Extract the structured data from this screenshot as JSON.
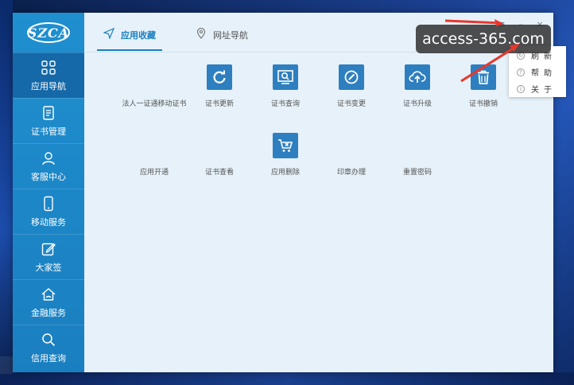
{
  "app": {
    "logo_text": "SZCA"
  },
  "sidebar": {
    "items": [
      {
        "label": "应用导航",
        "icon": "grid-icon",
        "active": true
      },
      {
        "label": "证书管理",
        "icon": "document-icon",
        "active": false
      },
      {
        "label": "客服中心",
        "icon": "user-icon",
        "active": false
      },
      {
        "label": "移动服务",
        "icon": "phone-icon",
        "active": false
      },
      {
        "label": "大家签",
        "icon": "edit-icon",
        "active": false
      },
      {
        "label": "金融服务",
        "icon": "home-icon",
        "active": false
      },
      {
        "label": "信用查询",
        "icon": "search-icon",
        "active": false
      }
    ]
  },
  "tabs": [
    {
      "label": "应用收藏",
      "icon": "send-icon",
      "active": true
    },
    {
      "label": "网址导航",
      "icon": "location-pin-icon",
      "active": false
    }
  ],
  "window_controls": [
    "menu-icon",
    "minimize-icon",
    "close-icon"
  ],
  "apps": {
    "row1": [
      {
        "label": "法人一证通移动证书",
        "icon": ""
      },
      {
        "label": "证书更新",
        "icon": "refresh-icon"
      },
      {
        "label": "证书查询",
        "icon": "certificate-search-icon"
      },
      {
        "label": "证书变更",
        "icon": "certificate-change-icon"
      },
      {
        "label": "证书升级",
        "icon": "upload-icon"
      },
      {
        "label": "证书撤销",
        "icon": "trash-icon"
      }
    ],
    "row2": [
      {
        "label": "应用开通",
        "icon": ""
      },
      {
        "label": "证书查看",
        "icon": ""
      },
      {
        "label": "应用删除",
        "icon": "cart-delete-icon"
      },
      {
        "label": "印章办理",
        "icon": ""
      },
      {
        "label": "重置密码",
        "icon": ""
      }
    ]
  },
  "dropdown_menu": {
    "items": [
      {
        "label": "刷新"
      },
      {
        "label": "帮助"
      },
      {
        "label": "关于"
      }
    ]
  },
  "watermark": {
    "text": "access-365.com"
  },
  "colors": {
    "sidebar": "#1a7fc0",
    "sidebar_active": "#1669a8",
    "accent": "#1a7fc0",
    "icon_tile": "#2e7fbf",
    "arrow": "#e8372d"
  }
}
